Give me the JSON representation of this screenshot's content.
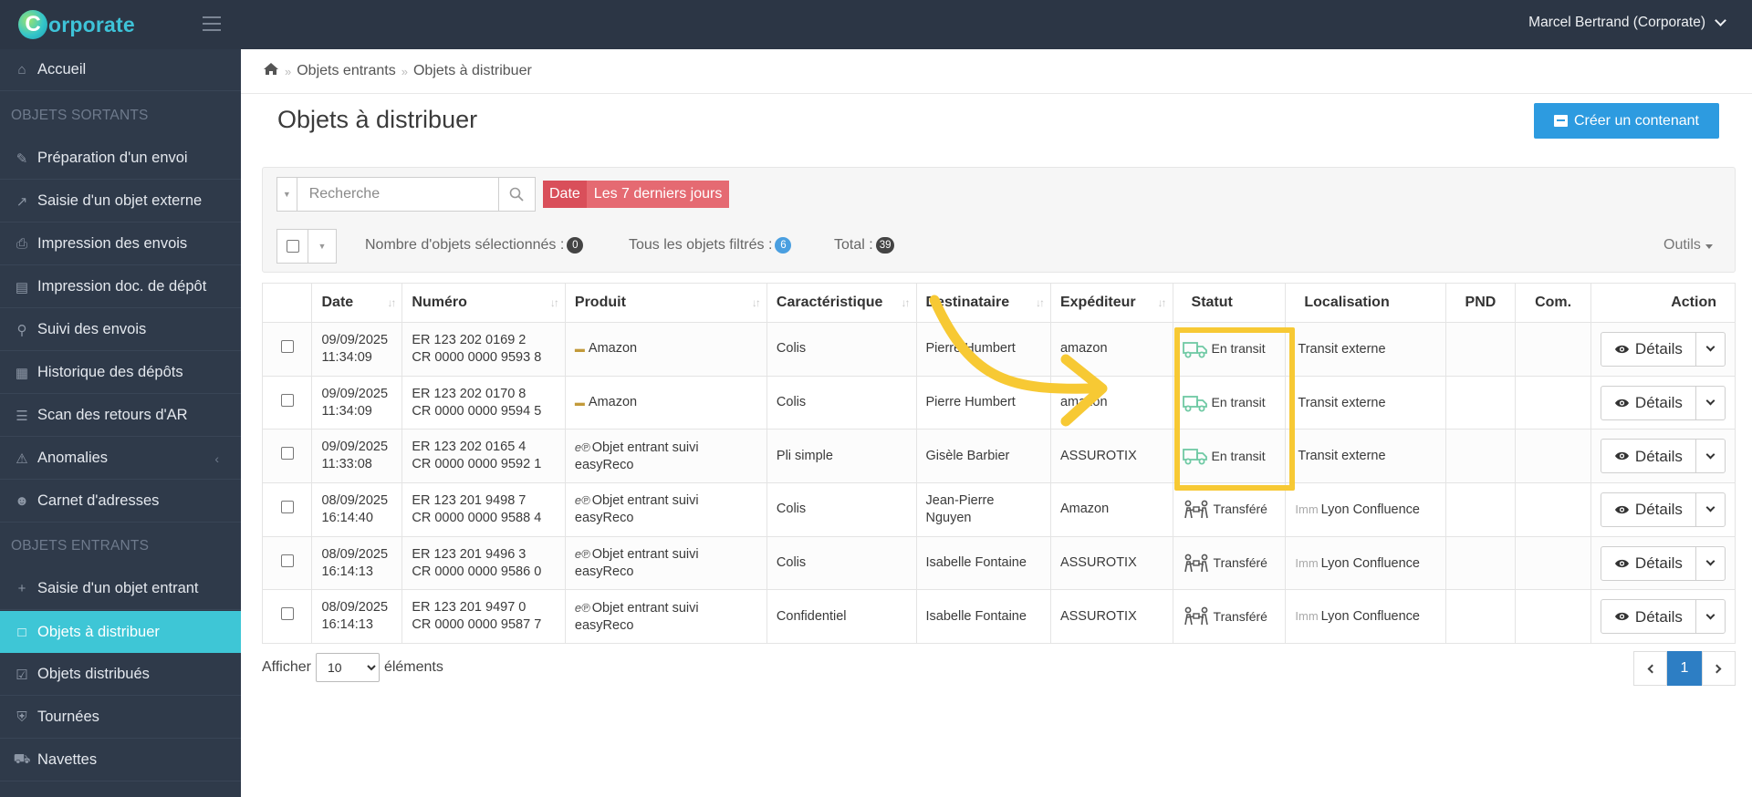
{
  "app": {
    "logo_letter": "C",
    "logo_text": "orporate",
    "user": "Marcel Bertrand (Corporate)"
  },
  "sidebar": {
    "home": "Accueil",
    "section_out": "OBJETS SORTANTS",
    "out_items": [
      "Préparation d'un envoi",
      "Saisie d'un objet externe",
      "Impression des envois",
      "Impression doc. de dépôt",
      "Suivi des envois",
      "Historique des dépôts",
      "Scan des retours d'AR",
      "Anomalies",
      "Carnet d'adresses"
    ],
    "section_in": "OBJETS ENTRANTS",
    "in_items": [
      "Saisie d'un objet entrant",
      "Objets à distribuer",
      "Objets distribués",
      "Tournées",
      "Navettes"
    ]
  },
  "breadcrumb": {
    "level1": "Objets entrants",
    "level2": "Objets à distribuer"
  },
  "page": {
    "title": "Objets à distribuer",
    "create_button": "Créer un contenant"
  },
  "filters": {
    "search_placeholder": "Recherche",
    "date_key": "Date",
    "date_value": "Les 7 derniers jours",
    "selected_label": "Nombre d'objets sélectionnés :",
    "selected_count": "0",
    "filtered_label": "Tous les objets filtrés :",
    "filtered_count": "6",
    "total_label": "Total :",
    "total_count": "39",
    "tools": "Outils"
  },
  "table": {
    "headers": {
      "date": "Date",
      "numero": "Numéro",
      "produit": "Produit",
      "carac": "Caractéristique",
      "dest": "Destinataire",
      "exp": "Expéditeur",
      "statut": "Statut",
      "loc": "Localisation",
      "pnd": "PND",
      "com": "Com.",
      "action": "Action"
    },
    "details_label": "Détails",
    "rows": [
      {
        "date": "09/09/2025",
        "time": "11:34:09",
        "er": "ER 123 202 0169 2",
        "cr": "CR 0000 0000 9593 8",
        "produit": "Amazon",
        "produit_icon": "amazon",
        "carac": "Colis",
        "dest": "Pierre Humbert",
        "exp": "amazon",
        "statut": "En transit",
        "statut_icon": "truck-icon",
        "loc_prefix": "",
        "loc": "Transit externe"
      },
      {
        "date": "09/09/2025",
        "time": "11:34:09",
        "er": "ER 123 202 0170 8",
        "cr": "CR 0000 0000 9594 5",
        "produit": "Amazon",
        "produit_icon": "amazon",
        "carac": "Colis",
        "dest": "Pierre Humbert",
        "exp": "amazon",
        "statut": "En transit",
        "statut_icon": "truck-icon",
        "loc_prefix": "",
        "loc": "Transit externe"
      },
      {
        "date": "09/09/2025",
        "time": "11:33:08",
        "er": "ER 123 202 0165 4",
        "cr": "CR 0000 0000 9592 1",
        "produit": "Objet entrant suivi easyReco",
        "produit_icon": "easyreco",
        "carac": "Pli simple",
        "dest": "Gisèle Barbier",
        "exp": "ASSUROTIX",
        "statut": "En transit",
        "statut_icon": "truck-icon",
        "loc_prefix": "",
        "loc": "Transit externe"
      },
      {
        "date": "08/09/2025",
        "time": "16:14:40",
        "er": "ER 123 201 9498 7",
        "cr": "CR 0000 0000 9588 4",
        "produit": "Objet entrant suivi easyReco",
        "produit_icon": "easyreco",
        "carac": "Colis",
        "dest": "Jean-Pierre Nguyen",
        "exp": "Amazon",
        "statut": "Transféré",
        "statut_icon": "transfer-icon",
        "loc_prefix": "Imm",
        "loc": "Lyon Confluence"
      },
      {
        "date": "08/09/2025",
        "time": "16:14:13",
        "er": "ER 123 201 9496 3",
        "cr": "CR 0000 0000 9586 0",
        "produit": "Objet entrant suivi easyReco",
        "produit_icon": "easyreco",
        "carac": "Colis",
        "dest": "Isabelle Fontaine",
        "exp": "ASSUROTIX",
        "statut": "Transféré",
        "statut_icon": "transfer-icon",
        "loc_prefix": "Imm",
        "loc": "Lyon Confluence"
      },
      {
        "date": "08/09/2025",
        "time": "16:14:13",
        "er": "ER 123 201 9497 0",
        "cr": "CR 0000 0000 9587 7",
        "produit": "Objet entrant suivi easyReco",
        "produit_icon": "easyreco",
        "carac": "Confidentiel",
        "dest": "Isabelle Fontaine",
        "exp": "ASSUROTIX",
        "statut": "Transféré",
        "statut_icon": "transfer-icon",
        "loc_prefix": "Imm",
        "loc": "Lyon Confluence"
      }
    ]
  },
  "footer": {
    "show_label": "Afficher",
    "per_page": "10",
    "elements_label": "éléments",
    "current_page": "1"
  },
  "colors": {
    "sidebar_active": "#3ec6d6",
    "primary_button": "#2d9be0",
    "date_tag": "#d94f5a",
    "annotation": "#f7c934",
    "pager_active": "#2d7ec4"
  }
}
